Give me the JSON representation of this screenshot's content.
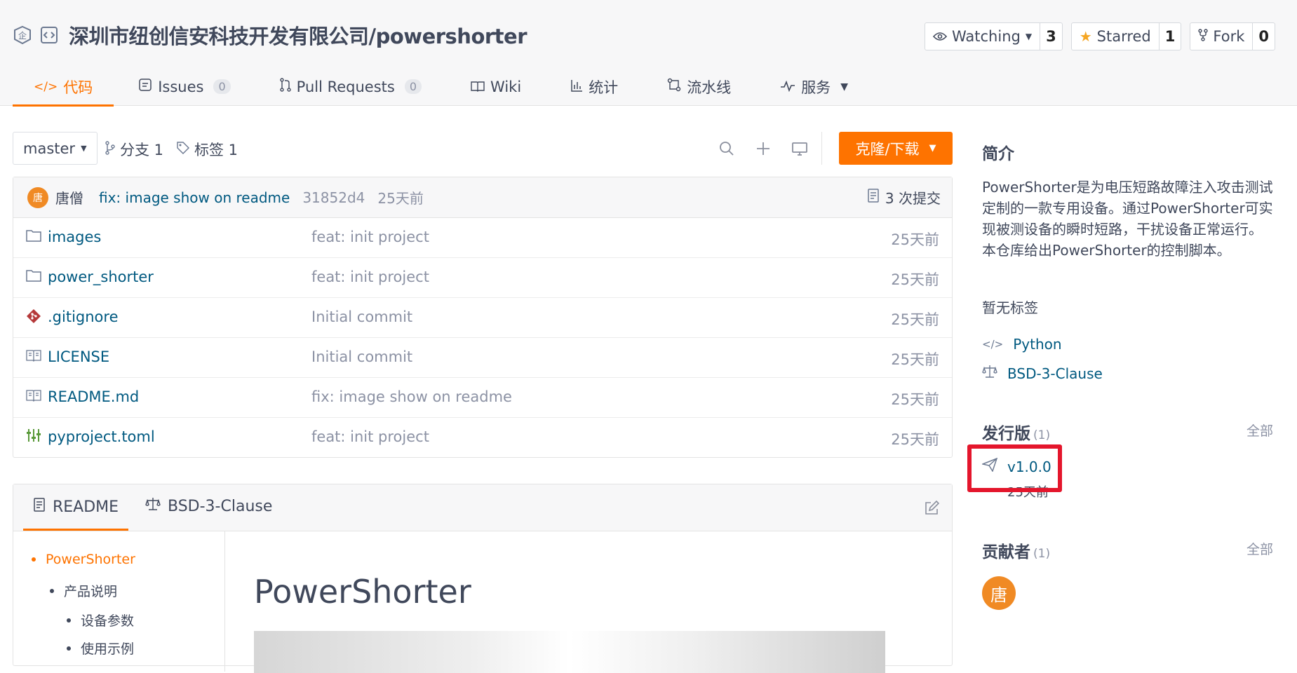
{
  "header": {
    "repo_title": "深圳市纽创信安科技开发有限公司/powershorter",
    "watch": {
      "label": "Watching",
      "count": "3"
    },
    "star": {
      "label": "Starred",
      "count": "1"
    },
    "fork": {
      "label": "Fork",
      "count": "0"
    }
  },
  "tabs": [
    {
      "label": "代码",
      "icon": "code-icon"
    },
    {
      "label": "Issues",
      "badge": "0",
      "icon": "issues-icon"
    },
    {
      "label": "Pull Requests",
      "badge": "0",
      "icon": "pull-request-icon"
    },
    {
      "label": "Wiki",
      "icon": "book-icon"
    },
    {
      "label": "统计",
      "icon": "bar-chart-icon"
    },
    {
      "label": "流水线",
      "icon": "pipeline-icon"
    },
    {
      "label": "服务",
      "icon": "pulse-icon"
    }
  ],
  "toolbar": {
    "branch": "master",
    "branches": "分支 1",
    "tags": "标签 1",
    "clone_label": "克隆/下载"
  },
  "commit": {
    "author": "唐僧",
    "avatar_char": "唐",
    "message": "fix: image show on readme",
    "hash": "31852d4",
    "time": "25天前",
    "count": "3 次提交"
  },
  "files": [
    {
      "name": "images",
      "icon": "folder-icon",
      "message": "feat: init project",
      "time": "25天前"
    },
    {
      "name": "power_shorter",
      "icon": "folder-icon",
      "message": "feat: init project",
      "time": "25天前"
    },
    {
      "name": ".gitignore",
      "icon": "git-icon",
      "message": "Initial commit",
      "time": "25天前"
    },
    {
      "name": "LICENSE",
      "icon": "book-icon",
      "message": "Initial commit",
      "time": "25天前"
    },
    {
      "name": "README.md",
      "icon": "book-icon",
      "message": "fix: image show on readme",
      "time": "25天前"
    },
    {
      "name": "pyproject.toml",
      "icon": "config-icon",
      "message": "feat: init project",
      "time": "25天前"
    }
  ],
  "readme": {
    "tab_readme": "README",
    "tab_license": "BSD-3-Clause",
    "toc": [
      "PowerShorter",
      "产品说明",
      "设备参数",
      "使用示例"
    ],
    "title": "PowerShorter"
  },
  "sidebar": {
    "intro_title": "简介",
    "intro_text": "PowerShorter是为电压短路故障注入攻击测试定制的一款专用设备。通过PowerShorter可实现被测设备的瞬时短路，干扰设备正常运行。本仓库给出PowerShorter的控制脚本。",
    "no_tags": "暂无标签",
    "language": "Python",
    "license": "BSD-3-Clause",
    "releases_title": "发行版",
    "releases_count": "(1)",
    "all": "全部",
    "release_version": "v1.0.0",
    "release_time": "25天前",
    "contributors_title": "贡献者",
    "contributors_count": "(1)",
    "contributor_avatar": "唐"
  },
  "colors": {
    "accent": "#fe7300",
    "link": "#005980",
    "highlight": "#e4162c"
  }
}
